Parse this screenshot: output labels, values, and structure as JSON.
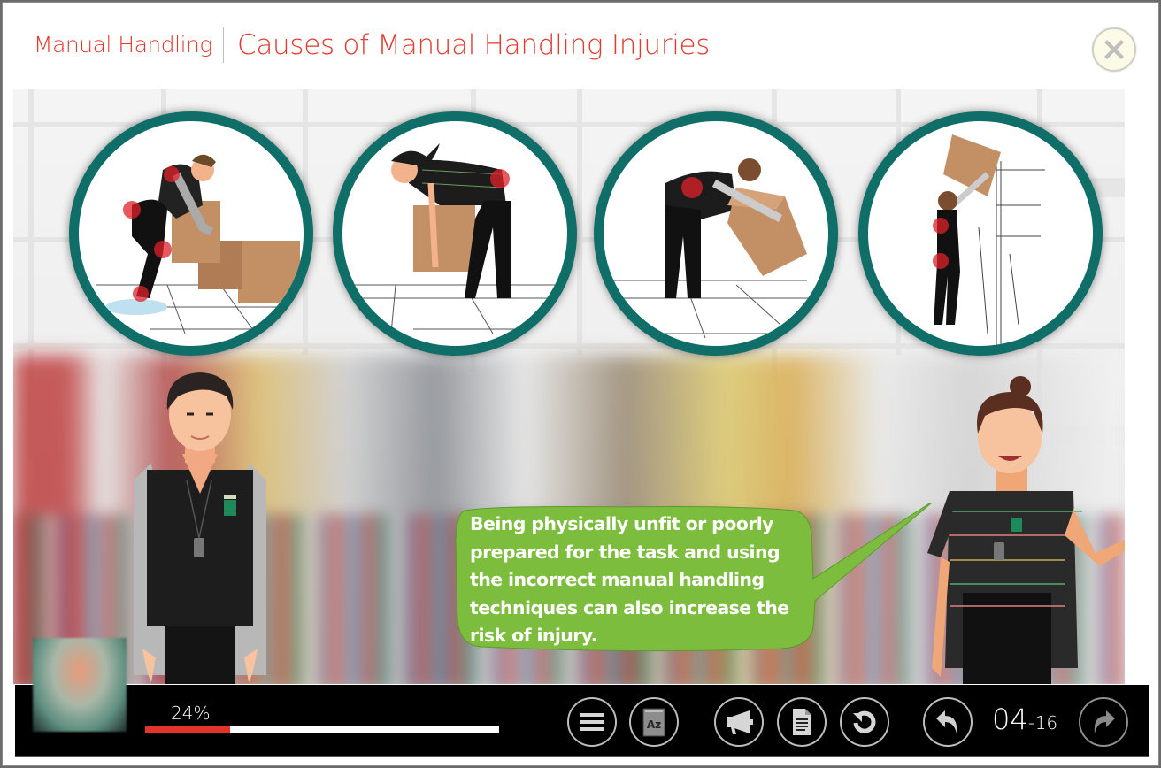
{
  "header": {
    "course_title": "Manual Handling",
    "page_title": "Causes of Manual Handling Injuries",
    "close_icon": "close-x-icon"
  },
  "stage": {
    "illustrations": [
      {
        "name": "bending-lifting-wet-floor",
        "depicts": "Man squatting to lift box from wet floor, pain highlighted at shoulder, hip, knee and ankle"
      },
      {
        "name": "stooping-lift",
        "depicts": "Woman bending at the waist to lift a box, pain highlighted at lower back"
      },
      {
        "name": "twisting-lift",
        "depicts": "Man bent over carrying a heavy box, pain highlighted at lower back"
      },
      {
        "name": "overhead-reach",
        "depicts": "Man reaching overhead to place a box on a high shelf, pain highlighted at back and hip"
      }
    ],
    "highlight_color": "#e0202a",
    "circle_border_color": "#0f6e68",
    "speech_bubble": {
      "lines": [
        "Being physically unfit or poorly",
        "prepared for the task and using",
        "the incorrect manual handling",
        "techniques can also increase the",
        "risk of injury."
      ],
      "color": "#7cbd3e"
    },
    "characters": [
      "male-staff-presenter",
      "female-staff-presenter"
    ]
  },
  "player": {
    "progress_percent": 24,
    "progress_label": "24%",
    "progress_color": "#e4342a",
    "buttons": [
      {
        "name": "menu-button",
        "icon": "hamburger-menu-icon"
      },
      {
        "name": "glossary-button",
        "icon": "glossary-az-icon",
        "icon_text": "Az"
      },
      {
        "name": "audio-button",
        "icon": "megaphone-icon"
      },
      {
        "name": "transcript-button",
        "icon": "document-icon"
      },
      {
        "name": "replay-button",
        "icon": "replay-icon"
      },
      {
        "name": "back-button",
        "icon": "back-arrow-icon"
      },
      {
        "name": "next-button",
        "icon": "next-arrow-icon"
      }
    ],
    "page_current": "04",
    "page_separator": "-",
    "page_total": "16"
  }
}
